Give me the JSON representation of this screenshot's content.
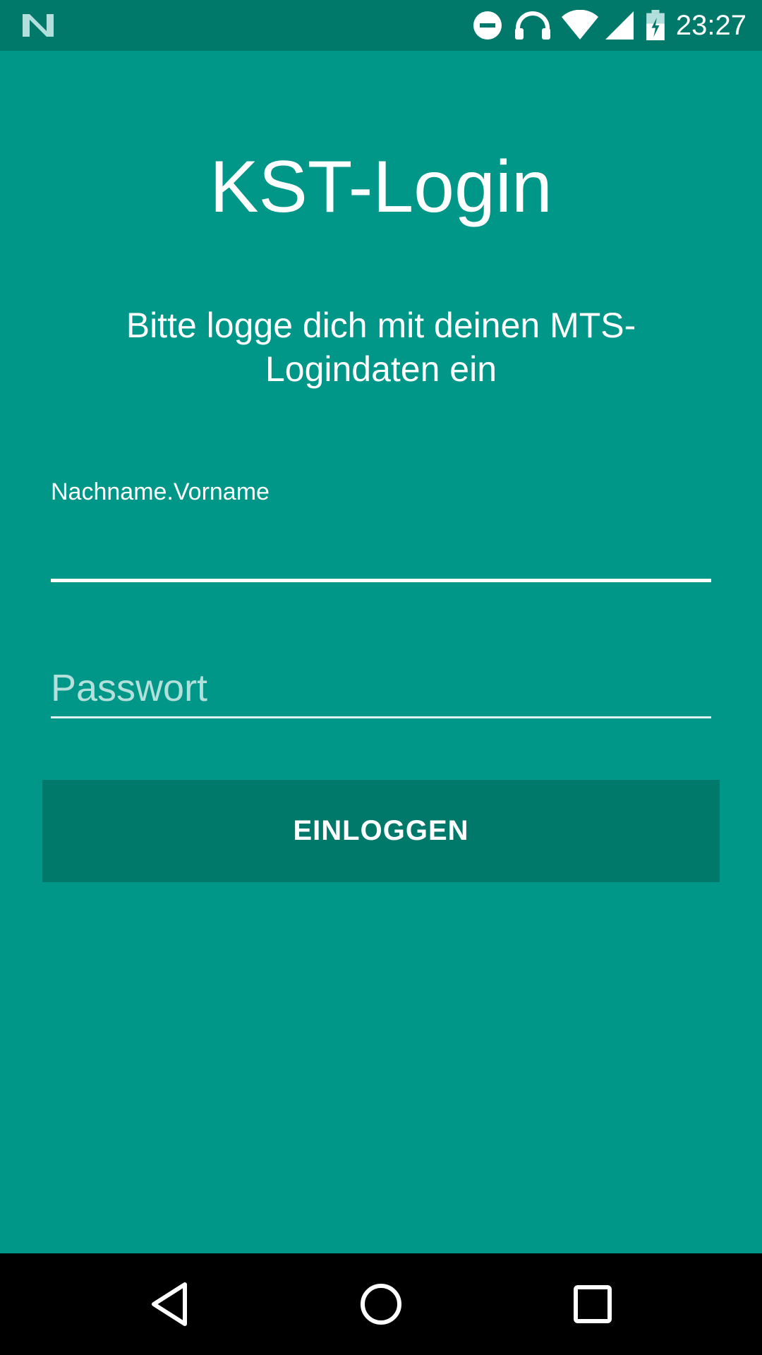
{
  "status_bar": {
    "time": "23:27",
    "icons": [
      "notification-n-icon",
      "do-not-disturb-icon",
      "headphones-icon",
      "wifi-icon",
      "cell-signal-icon",
      "battery-charging-icon"
    ]
  },
  "login": {
    "title": "KST-Login",
    "subtitle": "Bitte logge dich mit deinen MTS-Logindaten ein",
    "username_label": "Nachname.Vorname",
    "username_value": "",
    "password_placeholder": "Passwort",
    "login_button": "EINLOGGEN"
  },
  "nav_bar": {
    "icons": [
      "back-icon",
      "home-icon",
      "recents-icon"
    ]
  },
  "colors": {
    "background": "#009688",
    "status_bar": "#00796B",
    "button": "#00796B",
    "nav_bar": "#000000"
  }
}
